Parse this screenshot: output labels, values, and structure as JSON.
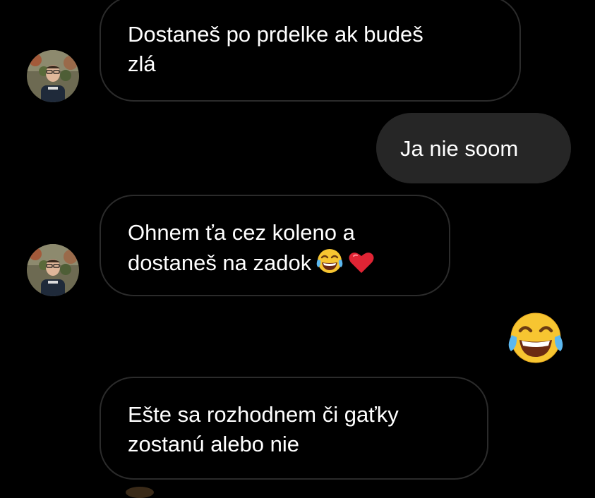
{
  "conversation": {
    "messages": [
      {
        "direction": "received",
        "lines": [
          "Dostaneš po prdelke ak budeš",
          "zlá"
        ]
      },
      {
        "direction": "sent",
        "lines": [
          "Ja nie soom"
        ]
      },
      {
        "direction": "received",
        "lines": [
          "Ohnem ťa cez koleno a",
          "dostaneš na zadok"
        ],
        "emojis": [
          "face-with-tears-of-joy",
          "red-heart"
        ]
      },
      {
        "direction": "sent",
        "emoji": "face-with-tears-of-joy"
      },
      {
        "direction": "received",
        "lines": [
          "Ešte sa rozhodnem či gaťky",
          "zostanú alebo nie"
        ]
      }
    ]
  },
  "colors": {
    "background": "#000000",
    "received_bubble_border": "#2b2b2b",
    "sent_bubble_fill": "#262626",
    "text": "#ffffff"
  }
}
